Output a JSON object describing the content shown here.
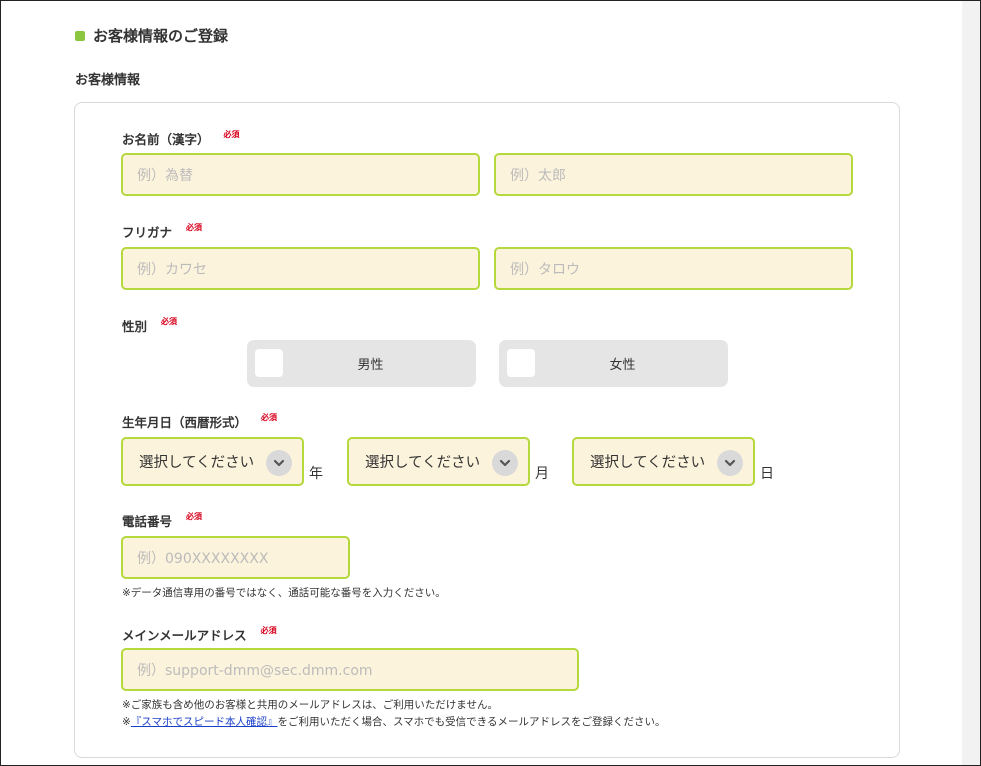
{
  "section_title": "お客様情報のご登録",
  "sub_title": "お客様情報",
  "required_label": "必須",
  "name": {
    "label": "お名前（漢字）",
    "last_placeholder": "例）為替",
    "first_placeholder": "例）太郎"
  },
  "furigana": {
    "label": "フリガナ",
    "last_placeholder": "例）カワセ",
    "first_placeholder": "例）タロウ"
  },
  "gender": {
    "label": "性別",
    "options": [
      "男性",
      "女性"
    ]
  },
  "birthdate": {
    "label": "生年月日（西暦形式）",
    "select_text": "選択してください",
    "year_unit": "年",
    "month_unit": "月",
    "day_unit": "日"
  },
  "phone": {
    "label": "電話番号",
    "placeholder": "例）090XXXXXXXX",
    "note": "※データ通信専用の番号ではなく、通話可能な番号を入力ください。"
  },
  "email": {
    "label": "メインメールアドレス",
    "placeholder": "例）support-dmm@sec.dmm.com",
    "note1": "※ご家族も含め他のお客様と共用のメールアドレスは、ご利用いただけません。",
    "note2_prefix": "※",
    "note2_link": "『スマホでスピード本人確認』",
    "note2_suffix": "をご利用いただく場合、スマホでも受信できるメールアドレスをご登録ください。"
  }
}
